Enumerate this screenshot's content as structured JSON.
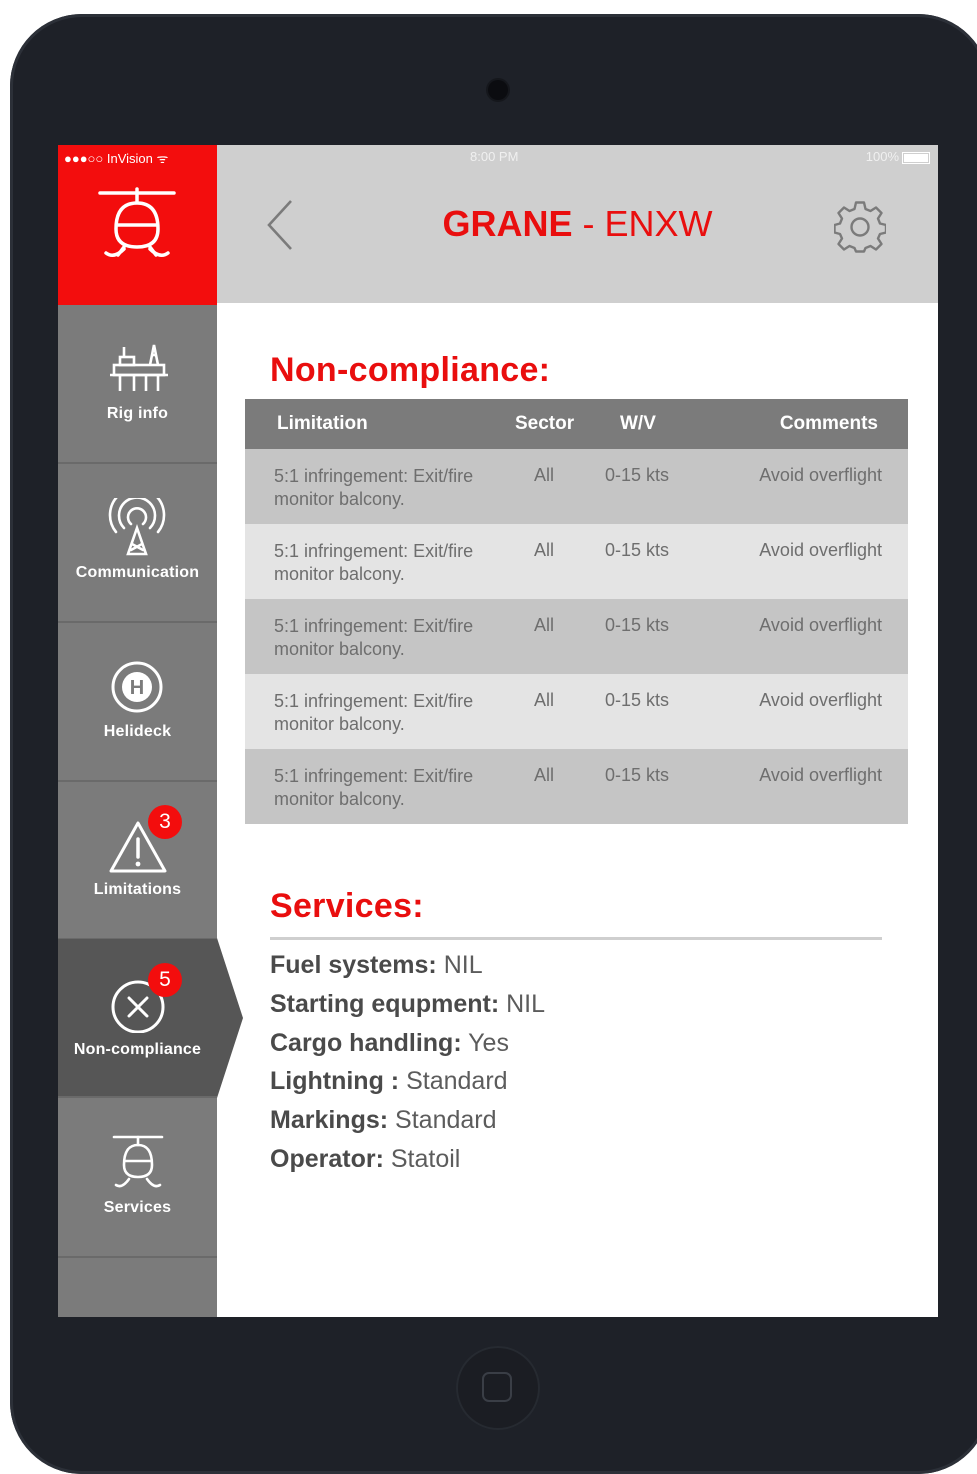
{
  "status_bar": {
    "carrier": "●●●○○ InVision ᯤ",
    "time": "8:00 PM",
    "battery": "100%"
  },
  "header": {
    "title_bold": "GRANE",
    "title_sep": " - ",
    "title_code": "ENXW"
  },
  "sidebar": {
    "items": [
      {
        "label": "Rig info",
        "icon": "rig-icon"
      },
      {
        "label": "Communication",
        "icon": "antenna-icon"
      },
      {
        "label": "Helideck",
        "icon": "helideck-icon",
        "icon_text": "H"
      },
      {
        "label": "Limitations",
        "icon": "warning-icon",
        "badge": "3"
      },
      {
        "label": "Non-compliance",
        "icon": "x-circle-icon",
        "badge": "5"
      },
      {
        "label": "Services",
        "icon": "helicopter-icon"
      }
    ]
  },
  "noncompliance": {
    "heading": "Non-compliance:",
    "columns": [
      "Limitation",
      "Sector",
      "W/V",
      "Comments"
    ],
    "rows": [
      {
        "limitation": "5:1 infringement: Exit/fire monitor balcony.",
        "sector": "All",
        "wv": "0-15 kts",
        "comments": "Avoid overflight"
      },
      {
        "limitation": "5:1 infringement: Exit/fire monitor balcony.",
        "sector": "All",
        "wv": "0-15 kts",
        "comments": "Avoid overflight"
      },
      {
        "limitation": "5:1 infringement: Exit/fire monitor balcony.",
        "sector": "All",
        "wv": "0-15 kts",
        "comments": "Avoid overflight"
      },
      {
        "limitation": "5:1 infringement: Exit/fire monitor balcony.",
        "sector": "All",
        "wv": "0-15 kts",
        "comments": "Avoid overflight"
      },
      {
        "limitation": "5:1 infringement: Exit/fire monitor balcony.",
        "sector": "All",
        "wv": "0-15 kts",
        "comments": "Avoid overflight"
      }
    ]
  },
  "services": {
    "heading": "Services:",
    "items": [
      {
        "key": "Fuel systems:",
        "value": "NIL"
      },
      {
        "key": "Starting equpment:",
        "value": "NIL"
      },
      {
        "key": "Cargo handling:",
        "value": "Yes"
      },
      {
        "key": "Lightning :",
        "value": "Standard"
      },
      {
        "key": "Markings:",
        "value": "Standard"
      },
      {
        "key": "Operator:",
        "value": "Statoil"
      }
    ]
  },
  "colors": {
    "brand_red": "#f30d0d",
    "sidebar_gray": "#7b7b7b",
    "header_gray": "#cfcfcf",
    "active_gray": "#565656"
  }
}
